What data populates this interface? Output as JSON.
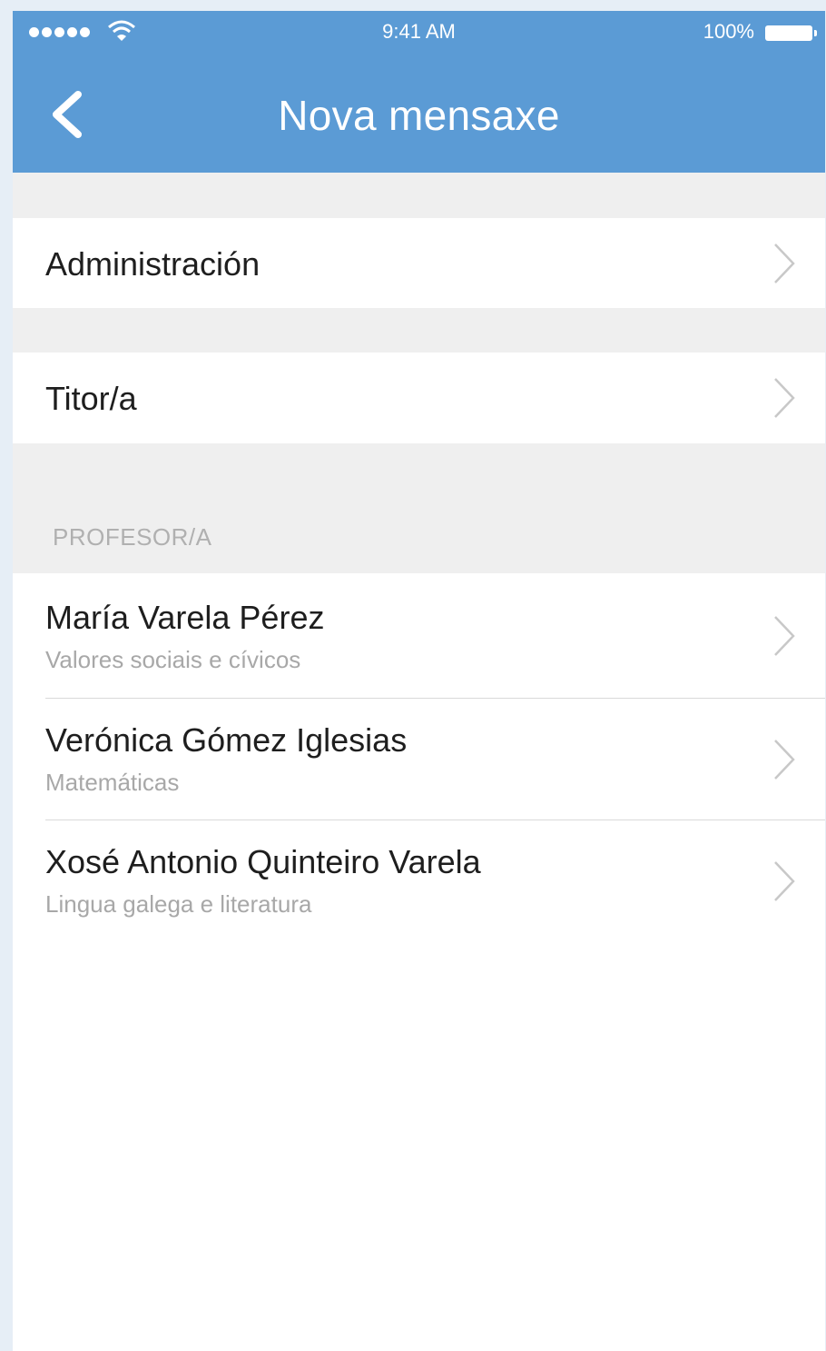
{
  "status_bar": {
    "time": "9:41 AM",
    "battery": "100%"
  },
  "nav": {
    "title": "Nova mensaxe"
  },
  "menu": [
    {
      "label": "Administración"
    },
    {
      "label": "Titor/a"
    }
  ],
  "section": {
    "header": "PROFESOR/A",
    "teachers": [
      {
        "name": "María Varela Pérez",
        "subject": "Valores sociais e cívicos"
      },
      {
        "name": "Verónica Gómez Iglesias",
        "subject": "Matemáticas"
      },
      {
        "name": "Xosé Antonio Quinteiro Varela",
        "subject": "Lingua galega e literatura"
      }
    ]
  },
  "colors": {
    "header": "#5b9bd5",
    "group_background": "#efefef"
  }
}
